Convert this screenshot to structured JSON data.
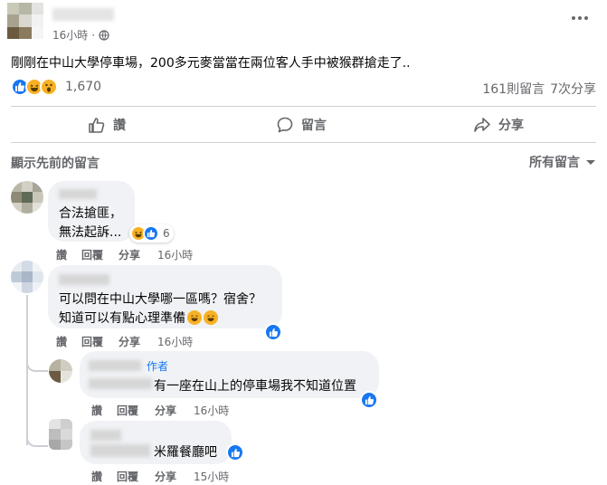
{
  "post": {
    "timestamp": "16小時",
    "text": "剛剛在中山大學停車場，200多元麥當當在兩位客人手中被猴群搶走了..",
    "reaction_count": "1,670",
    "comment_count": "161則留言",
    "share_count": "7次分享"
  },
  "actions": {
    "like": "讚",
    "comment": "留言",
    "share": "分享"
  },
  "comments_bar": {
    "show_previous": "顯示先前的留言",
    "filter": "所有留言"
  },
  "comments": [
    {
      "line1": "合法搶匪，",
      "line2": "無法起訴...",
      "reaction_count": "6",
      "like": "讚",
      "reply": "回覆",
      "share": "分享",
      "time": "16小時"
    },
    {
      "line1": "可以問在中山大學哪一區嗎？宿舍？",
      "line2": "知道可以有點心理準備",
      "like": "讚",
      "reply": "回覆",
      "share": "分享",
      "time": "16小時"
    }
  ],
  "replies": [
    {
      "author_badge": "作者",
      "text": "有一座在山上的停車場我不知道位置",
      "like": "讚",
      "reply": "回覆",
      "share": "分享",
      "time": "16小時"
    },
    {
      "text": "米羅餐廳吧",
      "like": "讚",
      "reply": "回覆",
      "share": "分享",
      "time": "15小時"
    }
  ],
  "colors": {
    "like_blue": "#1877f2",
    "haha_yellow": "#f7b125",
    "muted": "#65676b",
    "bubble": "#f0f2f5"
  }
}
